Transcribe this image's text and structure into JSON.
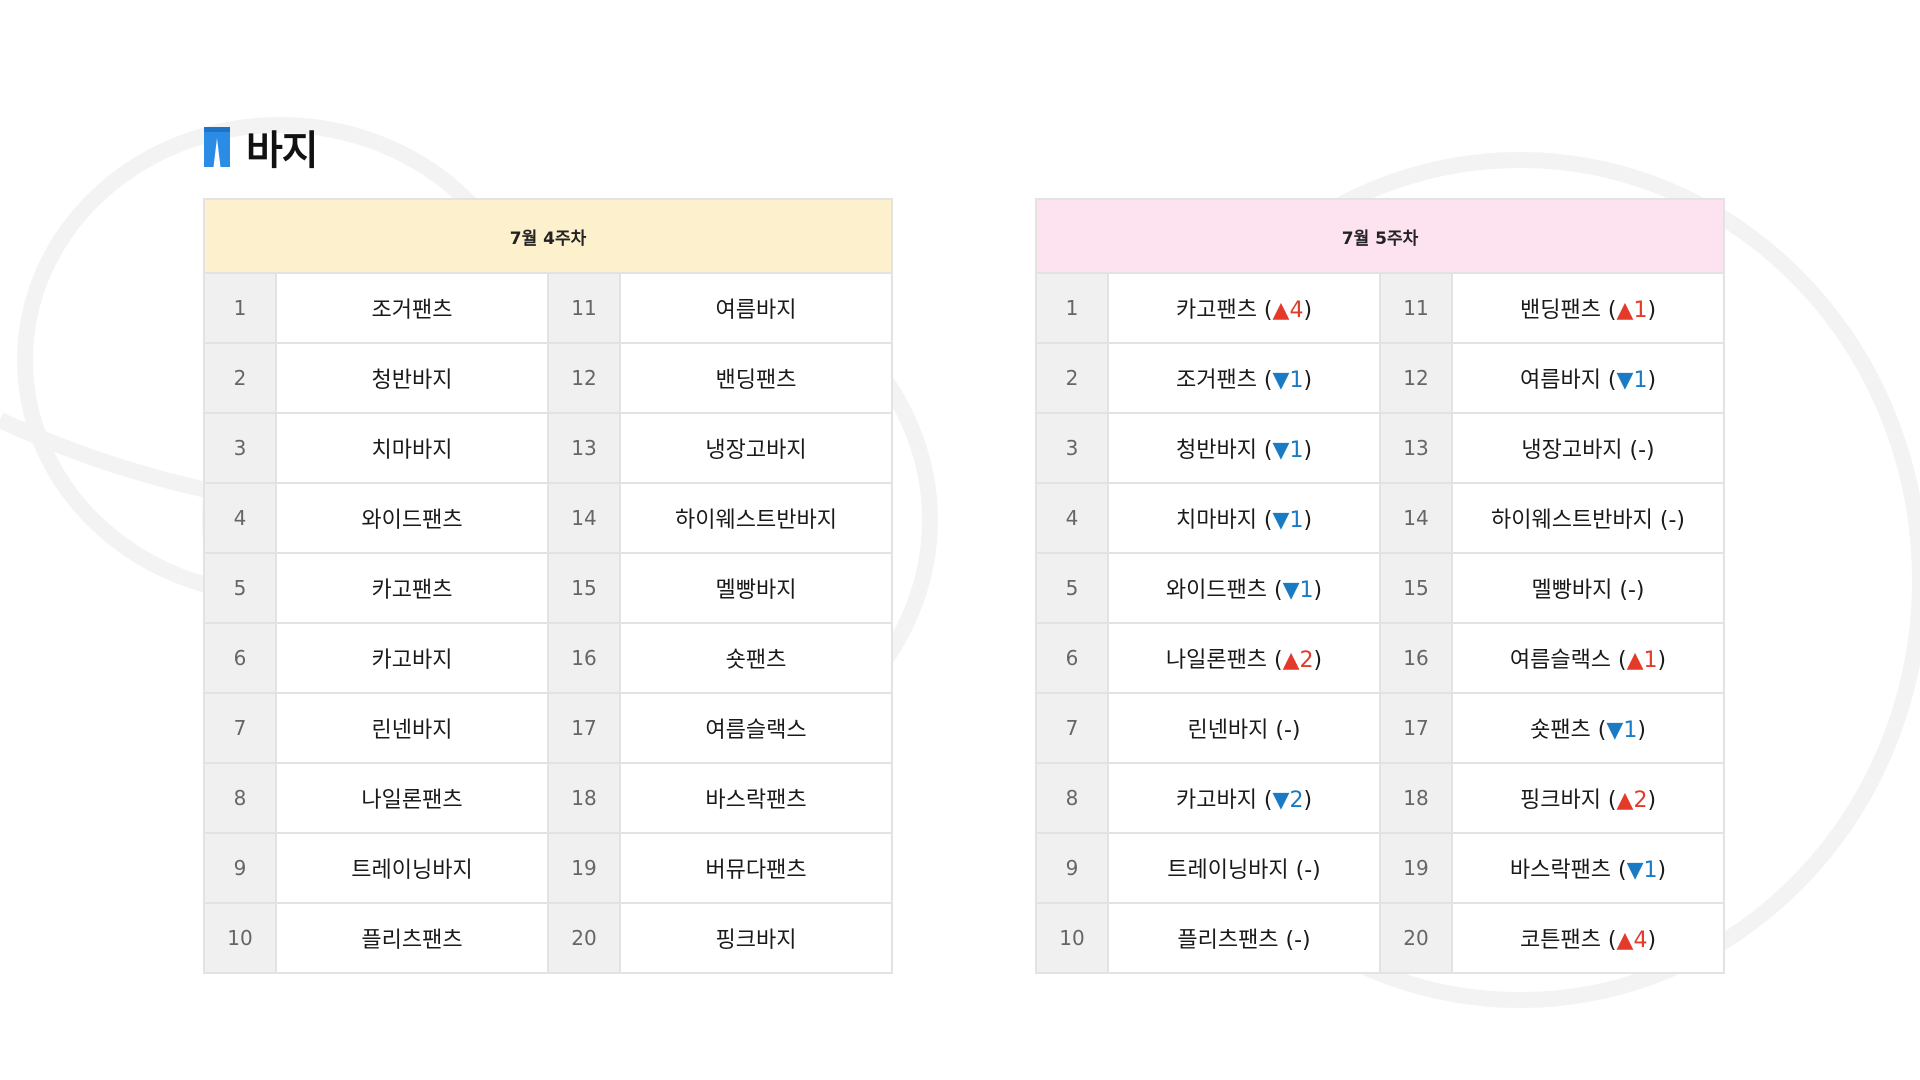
{
  "title": "바지",
  "icon": "pants-icon",
  "colors": {
    "accent_blue": "#2b8ce6",
    "week4_header_bg": "#fdf0cc",
    "week5_header_bg": "#fde3ef",
    "rank_up": "#e33a2a",
    "rank_down": "#1a7ac3"
  },
  "week4": {
    "header": "7월 4주차",
    "rows": [
      {
        "left_rank": "1",
        "left_name": "조거팬츠",
        "right_rank": "11",
        "right_name": "여름바지"
      },
      {
        "left_rank": "2",
        "left_name": "청반바지",
        "right_rank": "12",
        "right_name": "밴딩팬츠"
      },
      {
        "left_rank": "3",
        "left_name": "치마바지",
        "right_rank": "13",
        "right_name": "냉장고바지"
      },
      {
        "left_rank": "4",
        "left_name": "와이드팬츠",
        "right_rank": "14",
        "right_name": "하이웨스트반바지"
      },
      {
        "left_rank": "5",
        "left_name": "카고팬츠",
        "right_rank": "15",
        "right_name": "멜빵바지"
      },
      {
        "left_rank": "6",
        "left_name": "카고바지",
        "right_rank": "16",
        "right_name": "숏팬츠"
      },
      {
        "left_rank": "7",
        "left_name": "린넨바지",
        "right_rank": "17",
        "right_name": "여름슬랙스"
      },
      {
        "left_rank": "8",
        "left_name": "나일론팬츠",
        "right_rank": "18",
        "right_name": "바스락팬츠"
      },
      {
        "left_rank": "9",
        "left_name": "트레이닝바지",
        "right_rank": "19",
        "right_name": "버뮤다팬츠"
      },
      {
        "left_rank": "10",
        "left_name": "플리츠팬츠",
        "right_rank": "20",
        "right_name": "핑크바지"
      }
    ]
  },
  "week5": {
    "header": "7월 5주차",
    "rows": [
      {
        "left_rank": "1",
        "left": {
          "name": "카고팬츠",
          "open": " (",
          "arrow": "▲",
          "change": "4",
          "close": ")",
          "dir": "up"
        },
        "right_rank": "11",
        "right": {
          "name": "밴딩팬츠",
          "open": " (",
          "arrow": "▲",
          "change": "1",
          "close": ")",
          "dir": "up"
        }
      },
      {
        "left_rank": "2",
        "left": {
          "name": "조거팬츠",
          "open": " (",
          "arrow": "▼",
          "change": "1",
          "close": ")",
          "dir": "down"
        },
        "right_rank": "12",
        "right": {
          "name": "여름바지",
          "open": " (",
          "arrow": "▼",
          "change": "1",
          "close": ")",
          "dir": "down"
        }
      },
      {
        "left_rank": "3",
        "left": {
          "name": "청반바지",
          "open": " (",
          "arrow": "▼",
          "change": "1",
          "close": ")",
          "dir": "down"
        },
        "right_rank": "13",
        "right": {
          "name": "냉장고바지",
          "open": " (-)",
          "arrow": "",
          "change": "",
          "close": "",
          "dir": "none"
        }
      },
      {
        "left_rank": "4",
        "left": {
          "name": "치마바지",
          "open": " (",
          "arrow": "▼",
          "change": "1",
          "close": ")",
          "dir": "down"
        },
        "right_rank": "14",
        "right": {
          "name": "하이웨스트반바지",
          "open": " (-)",
          "arrow": "",
          "change": "",
          "close": "",
          "dir": "none"
        }
      },
      {
        "left_rank": "5",
        "left": {
          "name": "와이드팬츠",
          "open": " (",
          "arrow": "▼",
          "change": "1",
          "close": ")",
          "dir": "down"
        },
        "right_rank": "15",
        "right": {
          "name": "멜빵바지",
          "open": " (-)",
          "arrow": "",
          "change": "",
          "close": "",
          "dir": "none"
        }
      },
      {
        "left_rank": "6",
        "left": {
          "name": "나일론팬츠",
          "open": " (",
          "arrow": "▲",
          "change": "2",
          "close": ")",
          "dir": "up"
        },
        "right_rank": "16",
        "right": {
          "name": "여름슬랙스",
          "open": " (",
          "arrow": "▲",
          "change": "1",
          "close": ")",
          "dir": "up"
        }
      },
      {
        "left_rank": "7",
        "left": {
          "name": "린넨바지",
          "open": " (-)",
          "arrow": "",
          "change": "",
          "close": "",
          "dir": "none"
        },
        "right_rank": "17",
        "right": {
          "name": "숏팬츠",
          "open": " (",
          "arrow": "▼",
          "change": "1",
          "close": ")",
          "dir": "down"
        }
      },
      {
        "left_rank": "8",
        "left": {
          "name": "카고바지",
          "open": " (",
          "arrow": "▼",
          "change": "2",
          "close": ")",
          "dir": "down"
        },
        "right_rank": "18",
        "right": {
          "name": "핑크바지",
          "open": " (",
          "arrow": "▲",
          "change": "2",
          "close": ")",
          "dir": "up"
        }
      },
      {
        "left_rank": "9",
        "left": {
          "name": "트레이닝바지",
          "open": " (-)",
          "arrow": "",
          "change": "",
          "close": "",
          "dir": "none"
        },
        "right_rank": "19",
        "right": {
          "name": "바스락팬츠",
          "open": " (",
          "arrow": "▼",
          "change": "1",
          "close": ")",
          "dir": "down"
        }
      },
      {
        "left_rank": "10",
        "left": {
          "name": "플리츠팬츠",
          "open": " (-)",
          "arrow": "",
          "change": "",
          "close": "",
          "dir": "none"
        },
        "right_rank": "20",
        "right": {
          "name": "코튼팬츠",
          "open": " (",
          "arrow": "▲",
          "change": "4",
          "close": ")",
          "dir": "up"
        }
      }
    ]
  }
}
